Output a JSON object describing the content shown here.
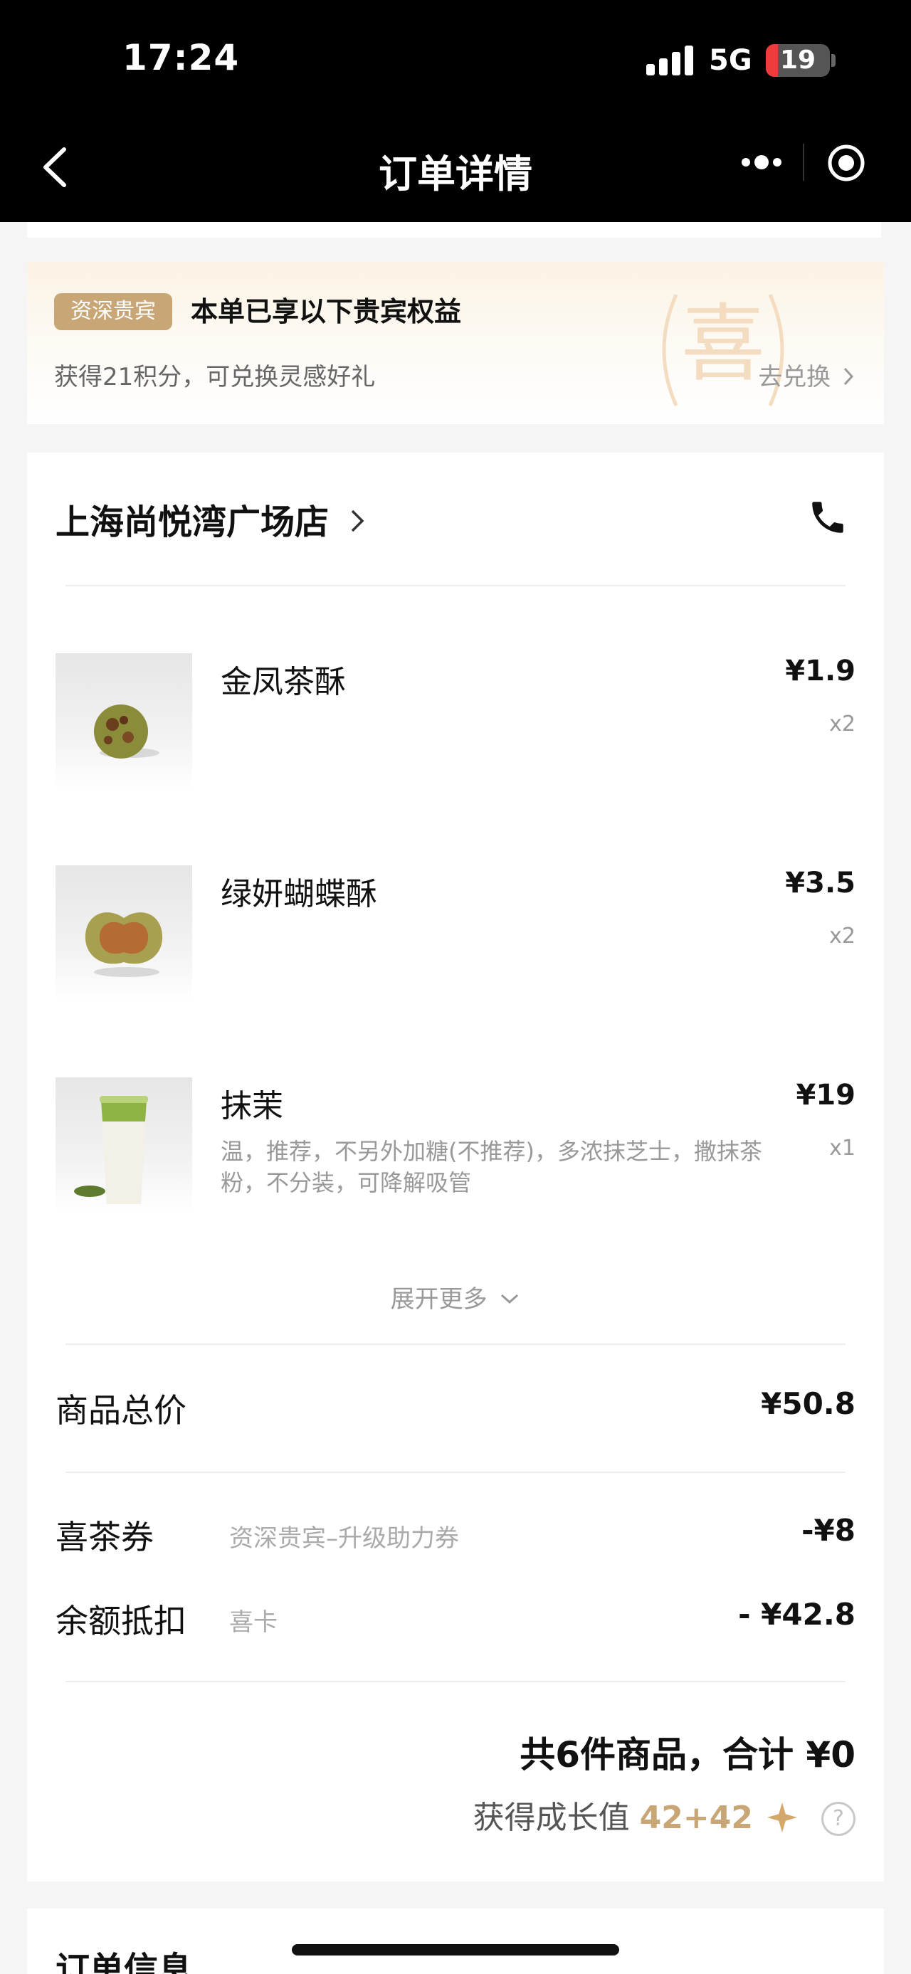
{
  "status_bar": {
    "time": "17:24",
    "network": "5G",
    "battery": "19",
    "battery_level": 0.19
  },
  "nav": {
    "title": "订单详情"
  },
  "benefit": {
    "badge": "资深贵宾",
    "title": "本单已享以下贵宾权益",
    "subtitle": "获得21积分，可兑换灵感好礼",
    "link": "去兑换",
    "watermark_char": "喜"
  },
  "store": {
    "name": "上海尚悦湾广场店"
  },
  "items": [
    {
      "name": "金凤茶酥",
      "price": "¥1.9",
      "qty": "x2",
      "desc": ""
    },
    {
      "name": "绿妍蝴蝶酥",
      "price": "¥3.5",
      "qty": "x2",
      "desc": ""
    },
    {
      "name": "抹茉",
      "price": "¥19",
      "qty": "x1",
      "desc": "温，推荐，不另外加糖(不推荐)，多浓抹芝士，撒抹茶粉，不分装，可降解吸管"
    }
  ],
  "expand_label": "展开更多",
  "summary": {
    "subtotal_label": "商品总价",
    "subtotal_value": "¥50.8",
    "coupon_label": "喜茶券",
    "coupon_desc": "资深贵宾–升级助力券",
    "coupon_value": "-¥8",
    "balance_label": "余额抵扣",
    "balance_desc": "喜卡",
    "balance_value": "- ¥42.8",
    "total_text": "共6件商品，合计 ¥0",
    "growth_label": "获得成长值",
    "growth_value": "42+42",
    "help_glyph": "?"
  },
  "next_section": {
    "title": "订单信息"
  },
  "colors": {
    "gold": "#c9a676",
    "battery_red": "#ef3b3b"
  }
}
